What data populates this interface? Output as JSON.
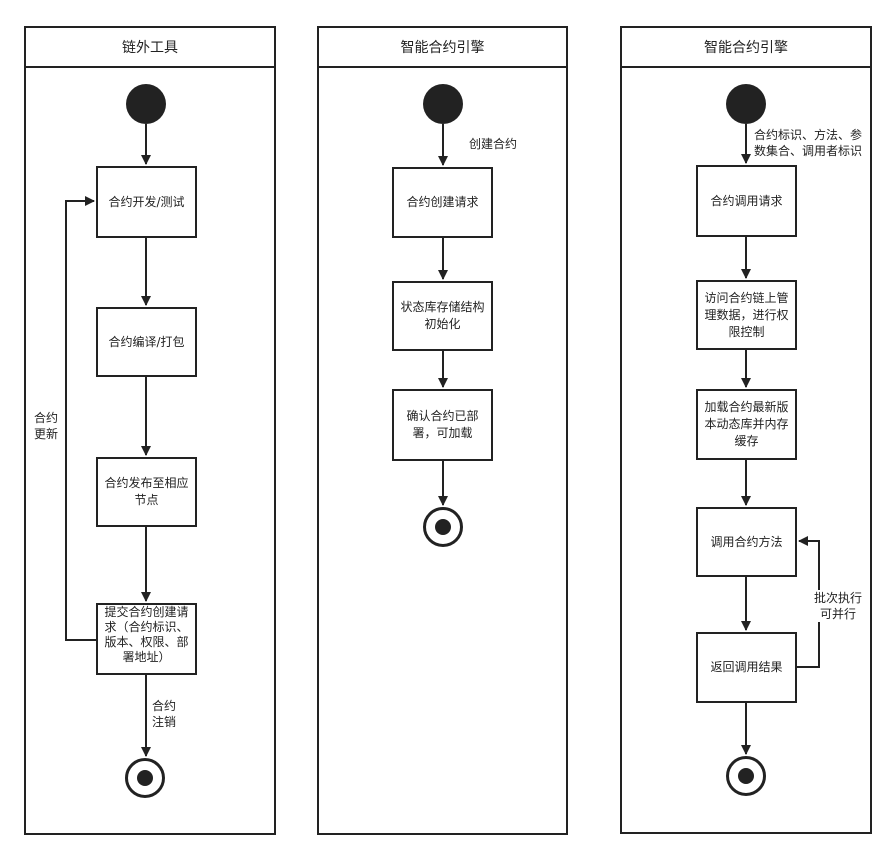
{
  "lanes": [
    {
      "title": "链外工具"
    },
    {
      "title": "智能合约引擎"
    },
    {
      "title": "智能合约引擎"
    }
  ],
  "lane1": {
    "nodes": [
      "合约开发/测试",
      "合约编译/打包",
      "合约发布至相应节点",
      "提交合约创建请求（合约标识、版本、权限、部署地址）"
    ],
    "labels": {
      "update": "合约\n更新",
      "cancel": "合约\n注销"
    }
  },
  "lane2": {
    "nodes": [
      "合约创建请求",
      "状态库存储结构初始化",
      "确认合约已部署，可加载"
    ],
    "labels": {
      "create": "创建合约"
    }
  },
  "lane3": {
    "nodes": [
      "合约调用请求",
      "访问合约链上管理数据，进行权限控制",
      "加载合约最新版本动态库并内存缓存",
      "调用合约方法",
      "返回调用结果"
    ],
    "labels": {
      "params": "合约标识、方法、参数集合、调用者标识",
      "batch": "批次执行\n可并行"
    }
  }
}
